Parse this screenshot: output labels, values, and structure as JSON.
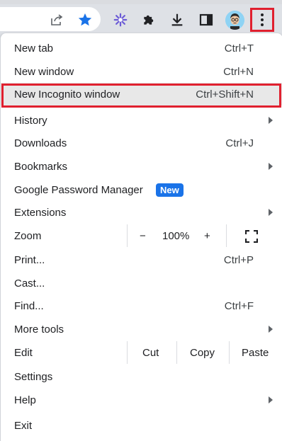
{
  "toolbar": {
    "share_icon": "share-icon",
    "bookmark_icon": "star-icon",
    "extension_flower_icon": "flower-extension-icon",
    "extensions_icon": "puzzle-icon",
    "download_icon": "download-icon",
    "side_panel_icon": "side-panel-icon",
    "profile_icon": "avatar",
    "menu_icon": "kebab-menu-icon"
  },
  "menu": {
    "new_tab": {
      "label": "New tab",
      "shortcut": "Ctrl+T"
    },
    "new_window": {
      "label": "New window",
      "shortcut": "Ctrl+N"
    },
    "new_incognito": {
      "label": "New Incognito window",
      "shortcut": "Ctrl+Shift+N"
    },
    "history": {
      "label": "History"
    },
    "downloads": {
      "label": "Downloads",
      "shortcut": "Ctrl+J"
    },
    "bookmarks": {
      "label": "Bookmarks"
    },
    "password_manager": {
      "label": "Google Password Manager",
      "badge": "New"
    },
    "extensions": {
      "label": "Extensions"
    },
    "zoom": {
      "label": "Zoom",
      "minus": "−",
      "value": "100%",
      "plus": "+"
    },
    "print": {
      "label": "Print...",
      "shortcut": "Ctrl+P"
    },
    "cast": {
      "label": "Cast..."
    },
    "find": {
      "label": "Find...",
      "shortcut": "Ctrl+F"
    },
    "more_tools": {
      "label": "More tools"
    },
    "edit": {
      "label": "Edit",
      "cut": "Cut",
      "copy": "Copy",
      "paste": "Paste"
    },
    "settings": {
      "label": "Settings"
    },
    "help": {
      "label": "Help"
    },
    "exit": {
      "label": "Exit"
    }
  },
  "colors": {
    "highlight": "#e0202f",
    "badge": "#1a73e8",
    "star": "#1a73e8"
  }
}
